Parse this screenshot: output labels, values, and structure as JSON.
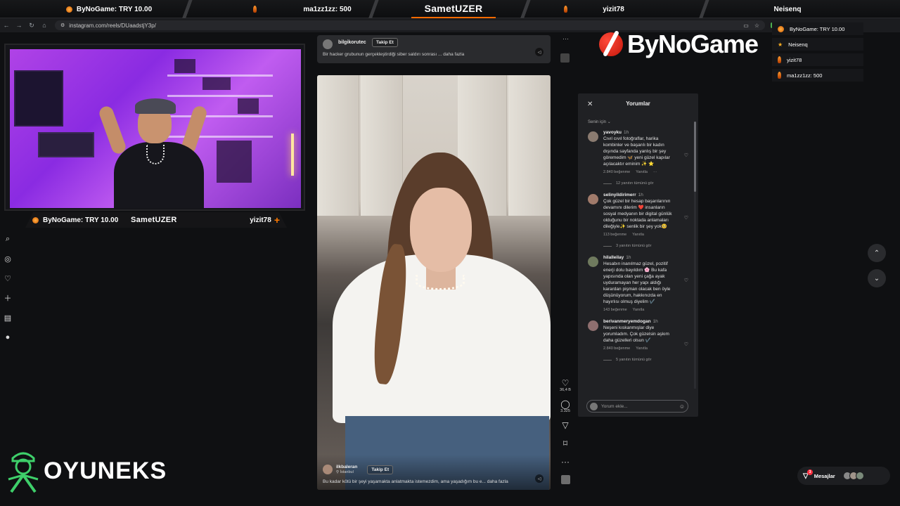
{
  "topbar": {
    "donation_1": "ByNoGame: TRY 10.00",
    "donation_2": "ma1zz1zz: 500",
    "streamer": "SametUZER",
    "follower_1": "yizit78",
    "follower_2": "Neisenq"
  },
  "browser": {
    "url": "instagram.com/reels/DUaadstjY3p/"
  },
  "webcam": {
    "left_label": "ByNoGame: TRY 10.00",
    "center_label": "SametUZER",
    "right_label": "yizit78"
  },
  "reel_top": {
    "username": "bilgikorutec",
    "follow_label": "Takip Et",
    "caption": "Bir hacker grubunun gerçekleştirdiği siber saldırı sonrası ... daha fazla"
  },
  "reel_main": {
    "username": "ilkbaleran",
    "location": "İstanbul",
    "follow_label": "Takip Et",
    "caption": "Bu kadar kötü bir şeyi yaşamakta anlatmakta istemezdim, ama yaşadığım bu e... daha fazla",
    "likes": "36,4 B",
    "comments": "3.325"
  },
  "comments_panel": {
    "title": "Yorumlar",
    "sort": "Senin için",
    "input_placeholder": "Yorum ekle...",
    "items": [
      {
        "user": "yavoyku",
        "time": "1h",
        "text": "Cıvıl cıvıl fotoğraflar, harika kombinler ve başarılı bir kadın dışında sayfanda yanlış bir şey göremedim 🦋 yeni güzel kapılar açılacaktır eminim ✨ ⭐",
        "likes": "2.840 beğenme",
        "reply": "Yanıtla",
        "replies": "12 yanıtın tümünü gör"
      },
      {
        "user": "selinyildirimerr",
        "time": "1h",
        "text": "Çok güzel bir hesap başarılarının devamını dilerim ❤️ insanların sosyal medyanın bir digital günlük olduğunu bir noktada anlamaları dileğiyle✨ senlik bir şey yok🥺",
        "likes": "113 beğenme",
        "reply": "Yanıtla",
        "replies": "3 yanıtın tümünü gör"
      },
      {
        "user": "hilalleilay",
        "time": "1h",
        "text": "Hesabın inanılmaz güzel, pozitif enerji dolu bayıldım 🌸 Bu kafa yapısında olan yeni çağa ayak uyduramayan her yapı aldığı karardan pişman olacak ben öyle düşünüyorum, hakkınızda en hayırlısı olmuş diyelim ✔️",
        "likes": "143 beğenme",
        "reply": "Yanıtla",
        "replies": ""
      },
      {
        "user": "berivanmeryemdogan",
        "time": "1h",
        "text": "Neşeni kıskanmışlar diye yorumladım. Çok güzelsin aşkım daha güzelleri olsun ✔️",
        "likes": "2.840 beğenme",
        "reply": "Yanıtla",
        "replies": "5 yanıtın tümünü gör"
      }
    ]
  },
  "bynogame": {
    "logo_text": "ByNoGame",
    "list": [
      "ByNoGame: TRY 10.00",
      "Neisenq",
      "yizit78",
      "ma1zz1zz: 500"
    ]
  },
  "messages": {
    "label": "Mesajlar",
    "badge": "3"
  },
  "oyuneks": {
    "logo_text": "OYUNEKS"
  },
  "colors": {
    "accent_orange": "#ff6a00",
    "ig_background": "#0f1012",
    "panel": "#202124",
    "brand_red": "#d6230f",
    "oyuneks_green": "#3ecf6a"
  },
  "icons": {
    "nav": [
      "search-icon",
      "explore-icon",
      "heart-icon",
      "plus-icon",
      "dashboard-icon",
      "profile-icon"
    ],
    "actions": [
      "heart-icon",
      "comment-icon",
      "send-icon",
      "bookmark-icon",
      "more-icon"
    ]
  }
}
